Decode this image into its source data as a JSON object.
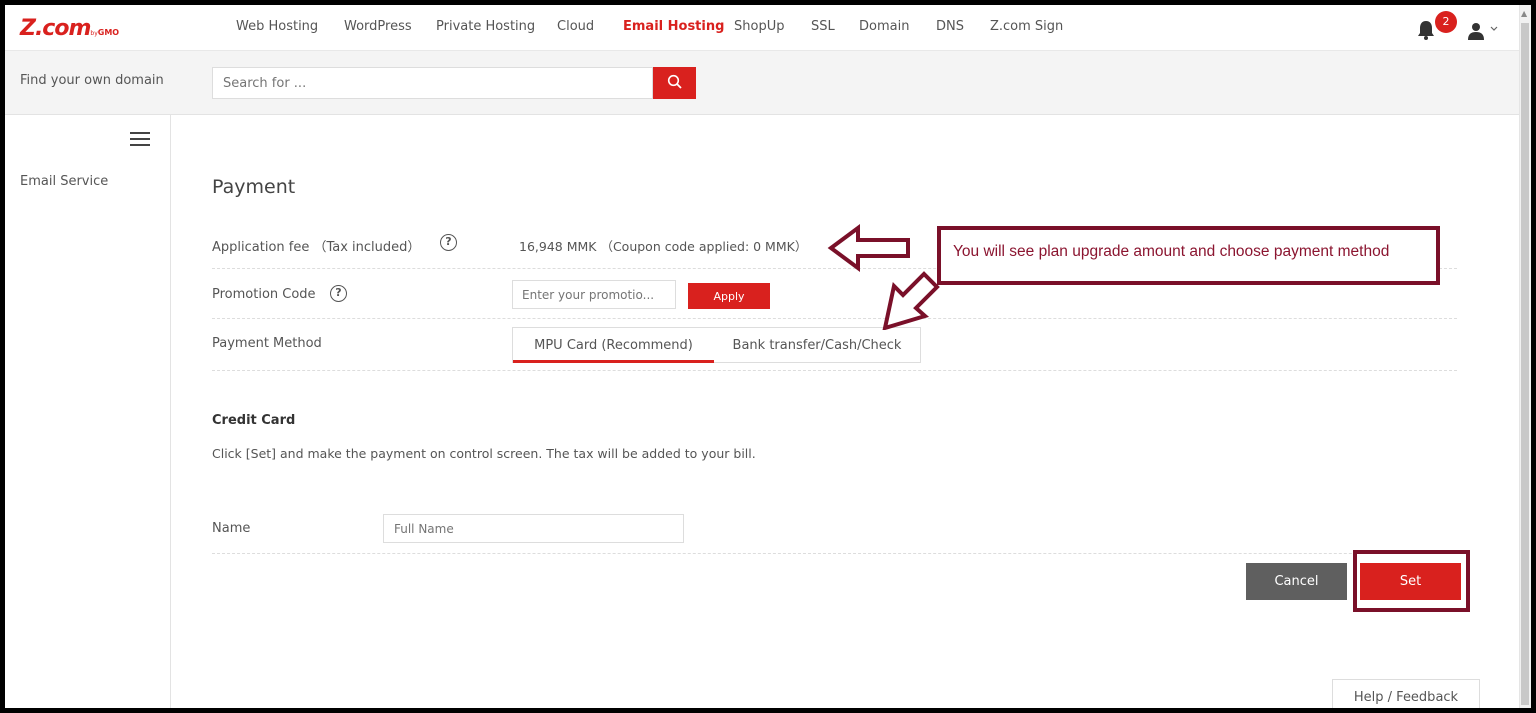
{
  "brand": {
    "logo": "Z.com",
    "by": "by",
    "gmo": "GMO",
    "accent": "#d9211e",
    "annotation_color": "#7a1029"
  },
  "nav": {
    "items": [
      {
        "label": "Web Hosting",
        "active": false
      },
      {
        "label": "WordPress",
        "active": false
      },
      {
        "label": "Private Hosting",
        "active": false
      },
      {
        "label": "Cloud",
        "active": false
      },
      {
        "label": "Email Hosting",
        "active": true
      },
      {
        "label": "ShopUp",
        "active": false
      },
      {
        "label": "SSL",
        "active": false
      },
      {
        "label": "Domain",
        "active": false
      },
      {
        "label": "DNS",
        "active": false
      },
      {
        "label": "Z.com Sign",
        "active": false
      }
    ],
    "notification_count": "2",
    "icons": [
      "bell-icon",
      "user-icon",
      "chevron-down-icon"
    ]
  },
  "search": {
    "label": "Find your own domain",
    "placeholder": "Search for ...",
    "button_icon": "search-icon"
  },
  "sidebar": {
    "menu_icon": "hamburger-icon",
    "items": [
      {
        "label": "Email Service"
      }
    ]
  },
  "payment": {
    "title": "Payment",
    "fee_label": "Application fee （Tax included）",
    "fee_value": "16,948 MMK （Coupon code applied:  0 MMK）",
    "promo_label": "Promotion Code",
    "promo_placeholder": "Enter your promotio...",
    "apply_label": "Apply",
    "method_label": "Payment Method",
    "methods": [
      {
        "label": "MPU Card (Recommend)",
        "selected": true
      },
      {
        "label": "Bank transfer/Cash/Check",
        "selected": false
      }
    ],
    "credit_card_title": "Credit Card",
    "credit_card_desc": "Click [Set] and make the payment on control screen. The tax will be added to your bill.",
    "name_label": "Name",
    "name_placeholder": "Full Name",
    "cancel_label": "Cancel",
    "set_label": "Set"
  },
  "help_feedback": "Help / Feedback",
  "annotation": {
    "text": "You will see plan upgrade amount and choose payment method"
  }
}
